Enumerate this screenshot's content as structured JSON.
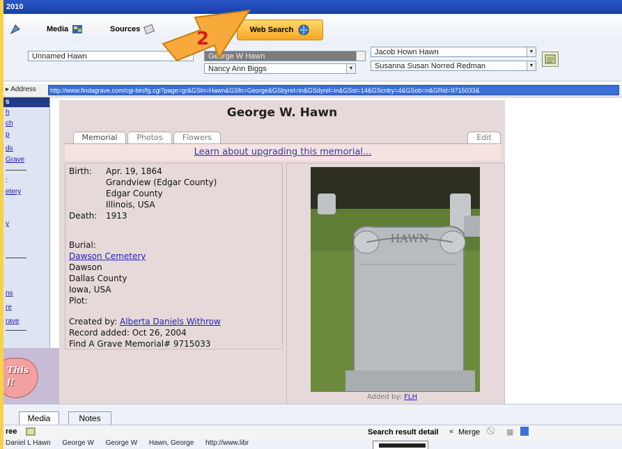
{
  "window": {
    "title": "2010"
  },
  "toolbar": {
    "media_label": "Media",
    "sources_label": "Sources",
    "web_search_label": "Web Search"
  },
  "annotation": {
    "step_number": "2",
    "arrow_color": "#f5a623"
  },
  "people": {
    "left_person": "Unnamed Hawn",
    "selected_person": "George W Hawn",
    "spouse": "Nancy Ann Biggs",
    "father": "Jacob Hown Hawn",
    "mother": "Susanna Susan Norred Redman"
  },
  "address_bar": {
    "label": "Address",
    "url": "http://www.findagrave.com/cgi-bin/fg.cgi?page=gr&GSln=Hawn&GSfn=George&GSbyrel=in&GSdyrel=in&GSst=14&GScntry=4&GSob=n&GRid=9715033&"
  },
  "left_nav": {
    "links": [
      "s",
      "h",
      "ch",
      "p",
      "ds",
      "Grave",
      ":",
      "etery",
      "y",
      "ns",
      "re",
      "rave"
    ],
    "promo_text_1": "This",
    "promo_text_2": "l!"
  },
  "memorial": {
    "name": "George W. Hawn",
    "tabs": [
      "Memorial",
      "Photos",
      "Flowers"
    ],
    "edit_label": "Edit",
    "upgrade_link": "Learn about upgrading this memorial...",
    "birth_label": "Birth:",
    "birth_date": "Apr. 19, 1864",
    "birth_place_1": "Grandview (Edgar County)",
    "birth_place_2": "Edgar County",
    "birth_place_3": "Illinois, USA",
    "death_label": "Death:",
    "death_date": "1913",
    "burial_label": "Burial:",
    "cemetery": "Dawson Cemetery",
    "burial_city": "Dawson",
    "burial_county": "Dallas County",
    "burial_state": "Iowa, USA",
    "plot_label": "Plot:",
    "created_by_label": "Created by:",
    "created_by": "Alberta Daniels Withrow",
    "record_added": "Record added: Oct 26, 2004",
    "memorial_number": "Find A Grave Memorial# 9715033",
    "photo_caption_label": "Added by:",
    "photo_caption_user": "FLH",
    "headstone_text": "HAWN"
  },
  "bottom": {
    "tabs": [
      "Media",
      "Notes"
    ],
    "tree_label": "ree",
    "search_result_label": "Search result detail",
    "merge_label": "Merge",
    "row_text": "Daniel L Hawn      George W      George W      Hawn, George      http://www.libr"
  }
}
